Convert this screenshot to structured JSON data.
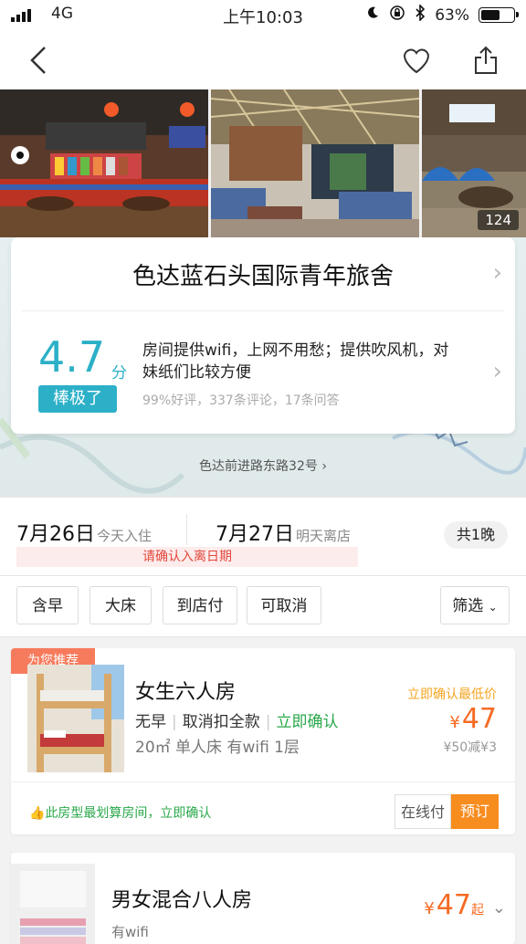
{
  "status": {
    "carrier": "4G",
    "time": "上午10:03",
    "battery": "63%",
    "battery_level": 0.63
  },
  "header": {
    "back_icon": "back-icon",
    "favorite_icon": "heart-icon",
    "share_icon": "share-icon"
  },
  "hero": {
    "photo_count": "124"
  },
  "hotel": {
    "name": "色达蓝石头国际青年旅舍",
    "score": "4.7",
    "score_unit": "分",
    "rating_label": "棒极了",
    "summary": "房间提供wifi，上网不用愁；提供吹风机，对妹纸们比较方便",
    "review_stats": "99%好评，337条评论，17条问答",
    "address": "色达前进路东路32号"
  },
  "dates": {
    "checkin": "7月26日",
    "checkin_note": "今天入住",
    "checkout": "7月27日",
    "checkout_note": "明天离店",
    "nights": "共1晚",
    "warning": "请确认入离日期"
  },
  "filters": [
    "含早",
    "大床",
    "到店付",
    "可取消"
  ],
  "filter_more": "筛选",
  "rooms": [
    {
      "badge": "为您推荐",
      "title": "女生六人房",
      "tags": [
        "无早",
        "取消扣全款",
        "立即确认"
      ],
      "spec": "20㎡ 单人床 有wifi 1层",
      "price_label": "立即确认最低价",
      "currency": "¥",
      "price": "47",
      "discount": "¥50减¥3",
      "note": "此房型最划算房间，立即确认",
      "pay_online": "在线付",
      "book": "预订"
    },
    {
      "title": "男女混合八人房",
      "spec": "有wifi",
      "currency": "¥",
      "price": "47",
      "price_suffix": "起"
    }
  ],
  "colors": {
    "accent": "#2bb0c7",
    "price": "#f56b24",
    "book": "#f78c1f",
    "recommend": "#f67b5c",
    "confirm": "#29a84a"
  }
}
